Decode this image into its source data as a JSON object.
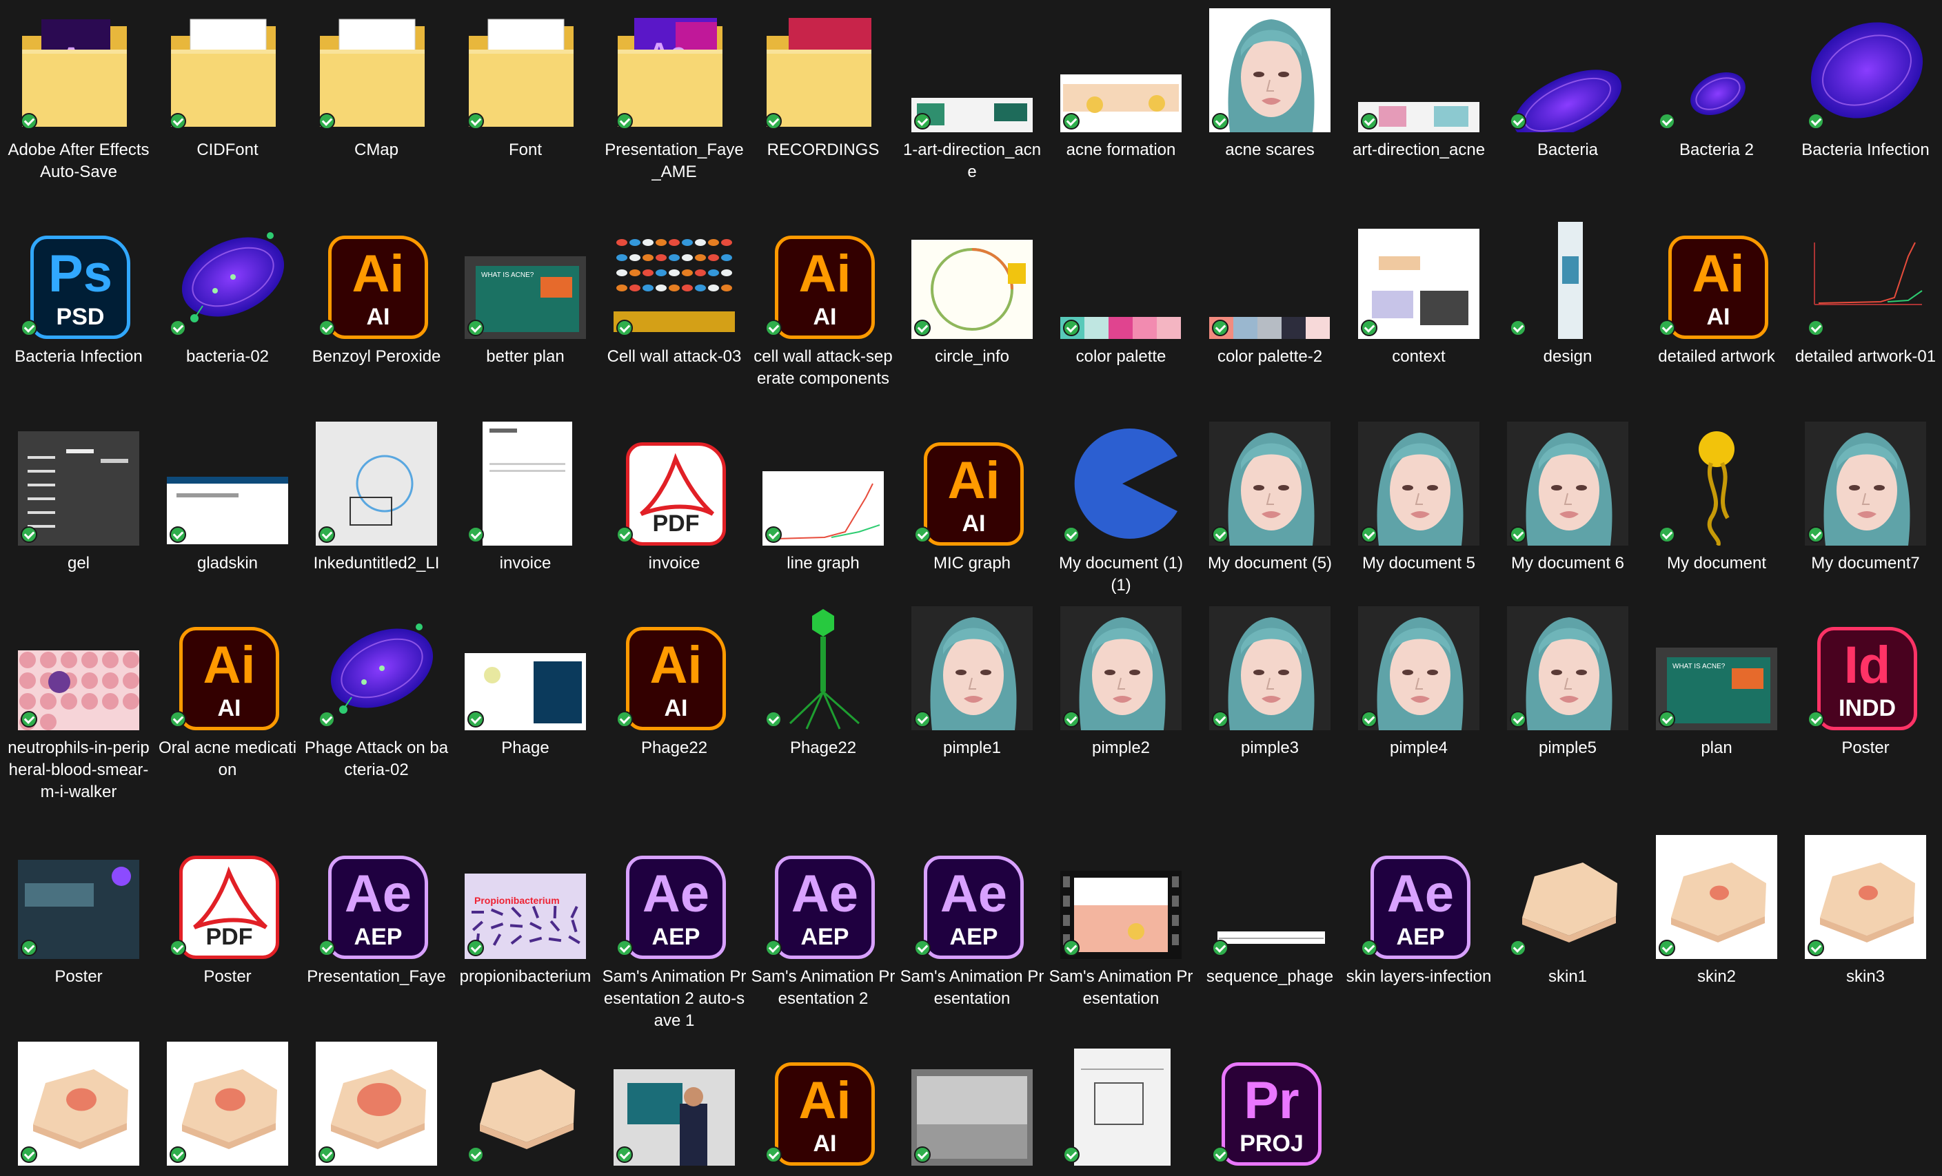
{
  "items": [
    {
      "name": "Adobe After Effects Auto-Save",
      "kind": "folder-ae"
    },
    {
      "name": "CIDFont",
      "kind": "folder"
    },
    {
      "name": "CMap",
      "kind": "folder"
    },
    {
      "name": "Font",
      "kind": "folder"
    },
    {
      "name": "Presentation_Faye_AME",
      "kind": "folder-ae-art"
    },
    {
      "name": "RECORDINGS",
      "kind": "folder-rec"
    },
    {
      "name": "1-art-direction_acne",
      "kind": "thumb-wide"
    },
    {
      "name": "acne formation",
      "kind": "thumb-acne"
    },
    {
      "name": "acne scares",
      "kind": "thumb-face-white"
    },
    {
      "name": "art-direction_acne",
      "kind": "thumb-wide2"
    },
    {
      "name": "Bacteria",
      "kind": "thumb-bacteria"
    },
    {
      "name": "Bacteria 2",
      "kind": "thumb-bacteria-small"
    },
    {
      "name": "Bacteria Infection",
      "kind": "thumb-bacteria-big"
    },
    {
      "name": "Bacteria Infection",
      "kind": "ps"
    },
    {
      "name": "bacteria-02",
      "kind": "thumb-bacteria-phage"
    },
    {
      "name": "Benzoyl Peroxide",
      "kind": "ai"
    },
    {
      "name": "better plan",
      "kind": "thumb-screen"
    },
    {
      "name": "Cell wall attack-03",
      "kind": "thumb-cellwall"
    },
    {
      "name": "cell wall attack-seperate components",
      "kind": "ai"
    },
    {
      "name": "circle_info",
      "kind": "thumb-circle"
    },
    {
      "name": "color palette",
      "kind": "thumb-palette1"
    },
    {
      "name": "color palette-2",
      "kind": "thumb-palette2"
    },
    {
      "name": "context",
      "kind": "thumb-doc-white"
    },
    {
      "name": "design",
      "kind": "thumb-tall"
    },
    {
      "name": "detailed artwork",
      "kind": "ai"
    },
    {
      "name": "detailed artwork-01",
      "kind": "thumb-graph-dark"
    },
    {
      "name": "gel",
      "kind": "thumb-gel"
    },
    {
      "name": "gladskin",
      "kind": "thumb-web"
    },
    {
      "name": "Inkeduntitled2_LI",
      "kind": "thumb-sketch"
    },
    {
      "name": "invoice",
      "kind": "thumb-invoice"
    },
    {
      "name": "invoice",
      "kind": "pdf"
    },
    {
      "name": "line graph",
      "kind": "thumb-linegraph"
    },
    {
      "name": "MIC graph",
      "kind": "ai"
    },
    {
      "name": "My document (1) (1)",
      "kind": "thumb-pacman"
    },
    {
      "name": "My document (5)",
      "kind": "thumb-face"
    },
    {
      "name": "My document 5",
      "kind": "thumb-face"
    },
    {
      "name": "My document 6",
      "kind": "thumb-face"
    },
    {
      "name": "My document",
      "kind": "thumb-yellow"
    },
    {
      "name": "My document7",
      "kind": "thumb-face"
    },
    {
      "name": "neutrophils-in-peripheral-blood-smear-m-i-walker",
      "kind": "thumb-blood"
    },
    {
      "name": "Oral acne medication",
      "kind": "ai"
    },
    {
      "name": "Phage Attack on bacteria-02",
      "kind": "thumb-bacteria-phage"
    },
    {
      "name": "Phage",
      "kind": "thumb-phage-doc"
    },
    {
      "name": "Phage22",
      "kind": "ai"
    },
    {
      "name": "Phage22",
      "kind": "thumb-phage-green"
    },
    {
      "name": "pimple1",
      "kind": "thumb-face"
    },
    {
      "name": "pimple2",
      "kind": "thumb-face"
    },
    {
      "name": "pimple3",
      "kind": "thumb-face"
    },
    {
      "name": "pimple4",
      "kind": "thumb-face"
    },
    {
      "name": "pimple5",
      "kind": "thumb-face"
    },
    {
      "name": "plan",
      "kind": "thumb-screen"
    },
    {
      "name": "Poster",
      "kind": "id"
    },
    {
      "name": "Poster",
      "kind": "thumb-poster"
    },
    {
      "name": "Poster",
      "kind": "pdf"
    },
    {
      "name": "Presentation_Faye",
      "kind": "ae"
    },
    {
      "name": "propionibacterium",
      "kind": "thumb-propioni"
    },
    {
      "name": "Sam's Animation Presentation 2 auto-save 1",
      "kind": "ae"
    },
    {
      "name": "Sam's Animation Presentation 2",
      "kind": "ae"
    },
    {
      "name": "Sam's Animation Presentation",
      "kind": "ae"
    },
    {
      "name": "Sam's Animation Presentation",
      "kind": "thumb-video"
    },
    {
      "name": "sequence_phage",
      "kind": "thumb-sequence"
    },
    {
      "name": "skin layers-infection",
      "kind": "ae"
    },
    {
      "name": "skin1",
      "kind": "thumb-skin-dark"
    },
    {
      "name": "skin2",
      "kind": "thumb-skin-white"
    },
    {
      "name": "skin3",
      "kind": "thumb-skin-white"
    },
    {
      "name": "",
      "kind": "thumb-skin-red"
    },
    {
      "name": "",
      "kind": "thumb-skin-red"
    },
    {
      "name": "",
      "kind": "thumb-skin-red2"
    },
    {
      "name": "",
      "kind": "thumb-skin-dark"
    },
    {
      "name": "",
      "kind": "thumb-photo"
    },
    {
      "name": "",
      "kind": "ai"
    },
    {
      "name": "",
      "kind": "thumb-photo-gray"
    },
    {
      "name": "",
      "kind": "thumb-sketch2"
    },
    {
      "name": "",
      "kind": "pr"
    }
  ],
  "app_icons": {
    "ai": {
      "abbr": "Ai",
      "ext": "AI",
      "fg": "#ff9a00",
      "bg": "#330000",
      "border": "#ff9a00"
    },
    "ae": {
      "abbr": "Ae",
      "ext": "AEP",
      "fg": "#d8a1ff",
      "bg": "#1f0040",
      "border": "#d8a1ff"
    },
    "ps": {
      "abbr": "Ps",
      "ext": "PSD",
      "fg": "#31a8ff",
      "bg": "#001e36",
      "border": "#31a8ff"
    },
    "id": {
      "abbr": "Id",
      "ext": "INDD",
      "fg": "#ff3366",
      "bg": "#49021f",
      "border": "#ff3366"
    },
    "pr": {
      "abbr": "Pr",
      "ext": "PROJ",
      "fg": "#ea77ff",
      "bg": "#2a0037",
      "border": "#ea77ff"
    },
    "pdf": {
      "abbr": "",
      "ext": "PDF",
      "fg": "#e12026",
      "bg": "#ffffff",
      "border": "#e12026"
    }
  },
  "colors": {
    "background": "#191919",
    "sync_check": "#2fae4c",
    "folder": "#f5cd62"
  }
}
